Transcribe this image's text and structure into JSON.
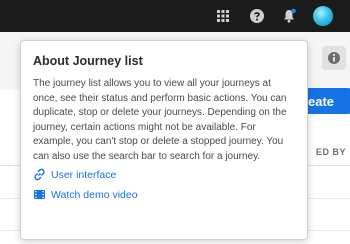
{
  "topbar": {
    "icons": [
      "apps-grid-icon",
      "help-icon",
      "notification-bell-icon",
      "user-avatar"
    ]
  },
  "header": {
    "create_label": "eate",
    "column_header_fragment": "ED BY"
  },
  "popover": {
    "title": "About Journey list",
    "body": "The journey list allows you to view all your journeys at once, see their status and perform basic actions. You can duplicate, stop or delete your journeys. Depending on the journey, certain actions might not be available. For example, you can't stop or delete a stopped journey. You can also use the search bar to search for a journey.",
    "links": [
      {
        "label": "User interface",
        "icon": "link-icon"
      },
      {
        "label": "Watch demo video",
        "icon": "video-icon"
      }
    ]
  },
  "colors": {
    "topbar": "#1b1b1b",
    "accent": "#1473e6",
    "notification_dot": "#2680eb"
  }
}
